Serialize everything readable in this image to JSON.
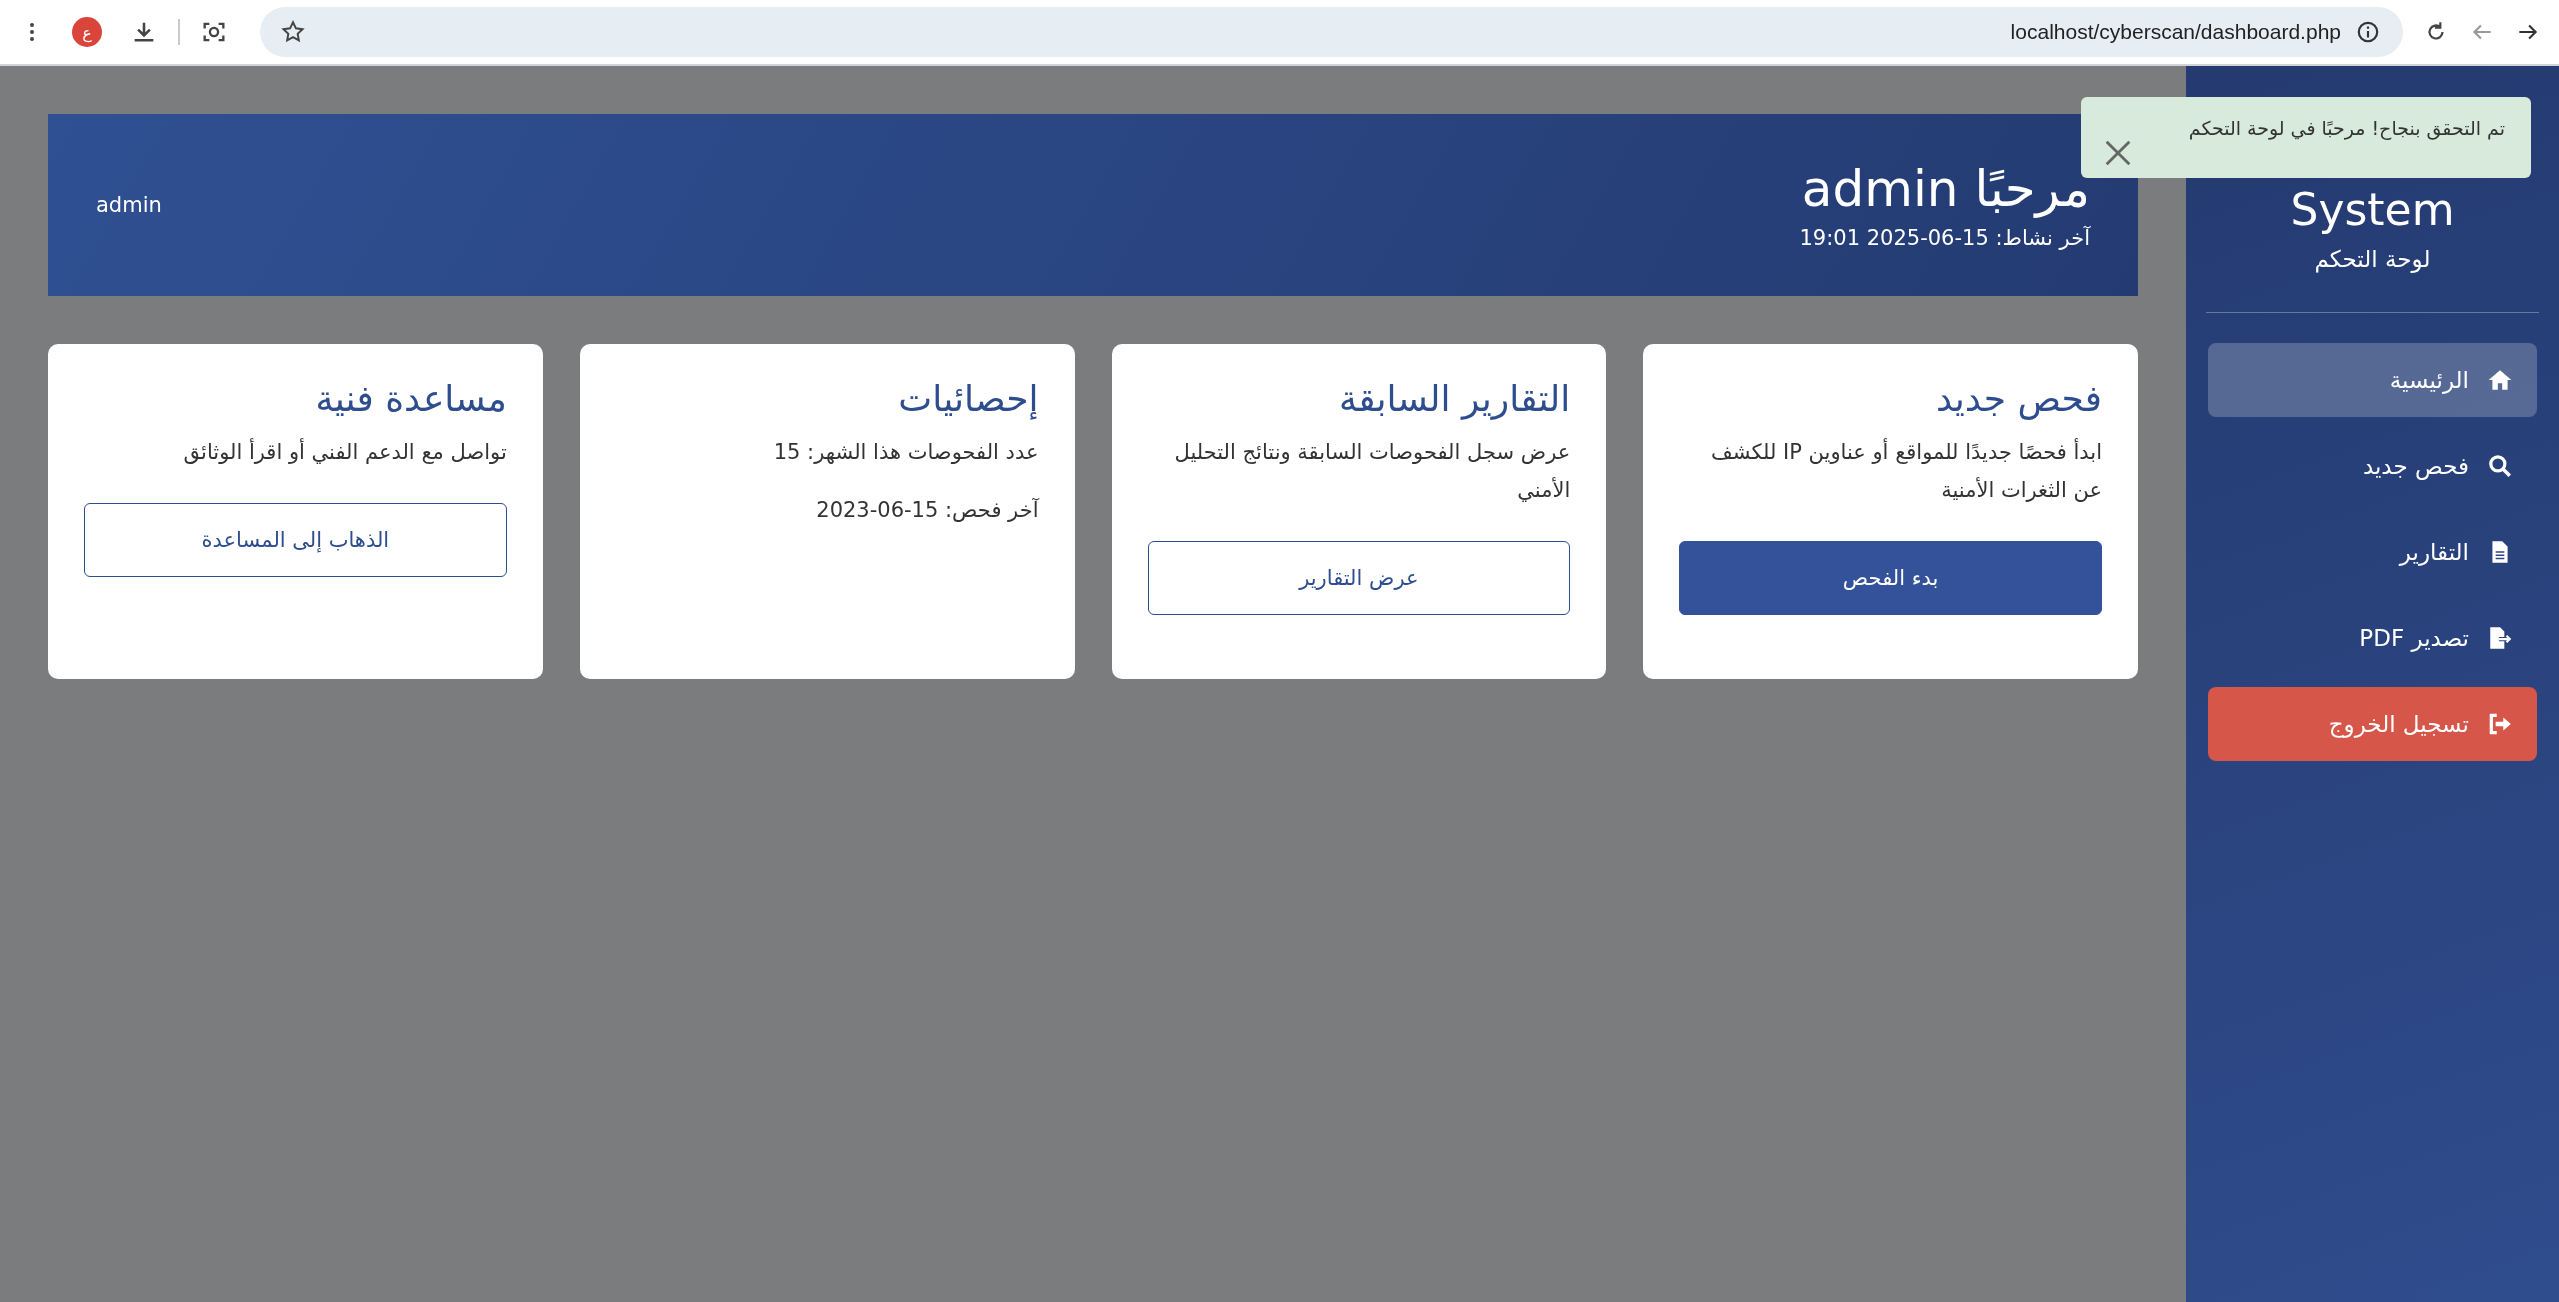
{
  "browser": {
    "avatar_letter": "ع",
    "url": "localhost/cyberscan/dashboard.php"
  },
  "sidebar": {
    "title": "System",
    "subtitle": "لوحة التحكم",
    "items": [
      {
        "label": "الرئيسية",
        "kind": "nav",
        "selected": true
      },
      {
        "label": "فحص جديد",
        "kind": "nav",
        "selected": false
      },
      {
        "label": "التقارير",
        "kind": "nav",
        "selected": false
      },
      {
        "label": "تصدير PDF",
        "kind": "nav",
        "selected": false
      },
      {
        "label": "تسجيل الخروج",
        "kind": "logout",
        "selected": false
      }
    ]
  },
  "header": {
    "title": "مرحبًا admin",
    "last_activity": "آخر نشاط: 15-06-2025 19:01",
    "user": "admin"
  },
  "cards": [
    {
      "title": "فحص جديد",
      "lines": [
        "ابدأ فحصًا جديدًا للمواقع أو عناوين IP للكشف عن الثغرات الأمنية"
      ],
      "button": {
        "label": "بدء الفحص",
        "kind": "primary"
      }
    },
    {
      "title": "التقارير السابقة",
      "lines": [
        "عرض سجل الفحوصات السابقة ونتائج التحليل الأمني"
      ],
      "button": {
        "label": "عرض التقارير",
        "kind": "outline"
      }
    },
    {
      "title": "إحصائيات",
      "lines": [
        "عدد الفحوصات هذا الشهر: 15",
        "آخر فحص: 15-06-2023"
      ]
    },
    {
      "title": "مساعدة فنية",
      "lines": [
        "تواصل مع الدعم الفني أو اقرأ الوثائق"
      ],
      "button": {
        "label": "الذهاب إلى المساعدة",
        "kind": "outline"
      }
    }
  ],
  "toast": {
    "message": "تم التحقق بنجاح! مرحبًا في لوحة التحكم"
  }
}
